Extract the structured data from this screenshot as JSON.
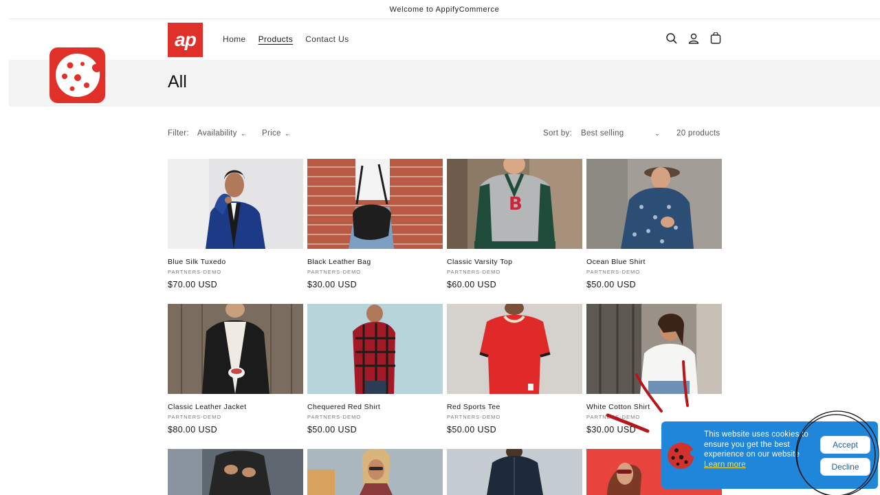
{
  "announcement": "Welcome to AppifyCommerce",
  "header": {
    "logo_text": "ap",
    "nav": [
      "Home",
      "Products",
      "Contact Us"
    ],
    "icons": [
      "search-icon",
      "account-icon",
      "cart-icon"
    ]
  },
  "page_title": "All",
  "filter": {
    "label": "Filter:",
    "availability": "Availability",
    "price": "Price",
    "sort_label": "Sort by:",
    "sort_value": "Best selling",
    "count": "20 products"
  },
  "products": [
    {
      "title": "Blue Silk Tuxedo",
      "vendor": "PARTNERS-DEMO",
      "price": "$70.00 USD"
    },
    {
      "title": "Black Leather Bag",
      "vendor": "PARTNERS-DEMO",
      "price": "$30.00 USD"
    },
    {
      "title": "Classic Varsity Top",
      "vendor": "PARTNERS-DEMO",
      "price": "$60.00 USD"
    },
    {
      "title": "Ocean Blue Shirt",
      "vendor": "PARTNERS-DEMO",
      "price": "$50.00 USD"
    },
    {
      "title": "Classic Leather Jacket",
      "vendor": "PARTNERS-DEMO",
      "price": "$80.00 USD"
    },
    {
      "title": "Chequered Red Shirt",
      "vendor": "PARTNERS-DEMO",
      "price": "$50.00 USD"
    },
    {
      "title": "Red Sports Tee",
      "vendor": "PARTNERS-DEMO",
      "price": "$50.00 USD"
    },
    {
      "title": "White Cotton Shirt",
      "vendor": "PARTNERS-DEMO",
      "price": "$30.00 USD"
    }
  ],
  "cookie_popup": {
    "message": "This website uses cookies to ensure you get the best experience on our website",
    "learn_more": "Learn more",
    "accept": "Accept",
    "decline": "Decline"
  },
  "colors": {
    "brand_red": "#e0302a",
    "popup_blue": "#1f86d9",
    "link_yellow": "#ffe24a",
    "annotation_red": "#b5171b"
  }
}
